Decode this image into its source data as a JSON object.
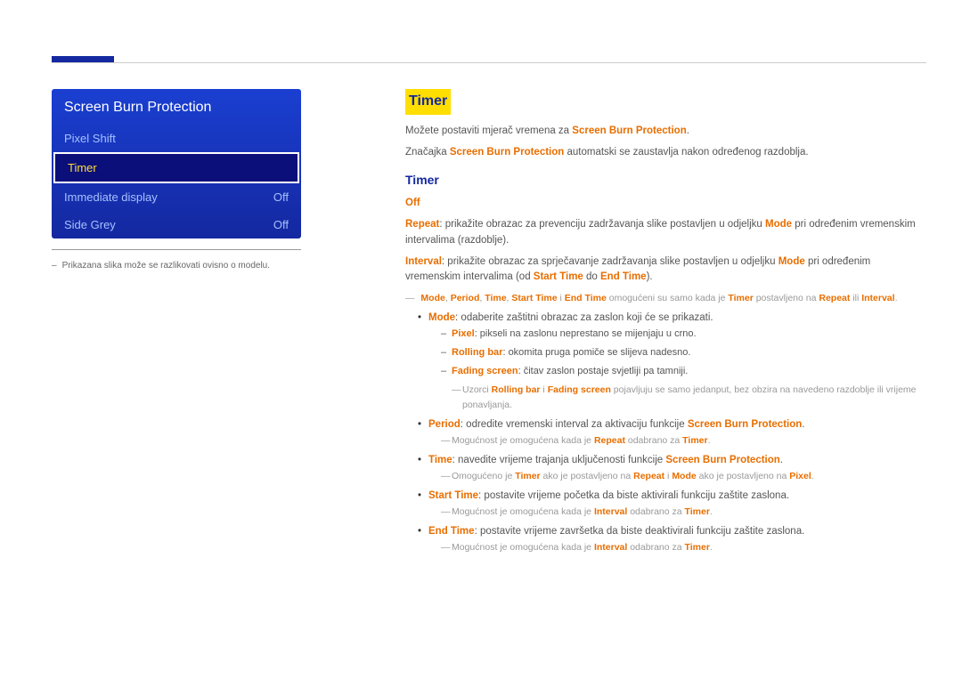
{
  "menu": {
    "title": "Screen Burn Protection",
    "items": [
      {
        "label": "Pixel Shift",
        "value": ""
      },
      {
        "label": "Timer",
        "value": ""
      },
      {
        "label": "Immediate display",
        "value": "Off"
      },
      {
        "label": "Side Grey",
        "value": "Off"
      }
    ]
  },
  "caption": "Prikazana slika može se razlikovati ovisno o modelu.",
  "section_title": "Timer",
  "intro1_a": "Možete postaviti mjerač vremena za ",
  "intro1_b": "Screen Burn Protection",
  "intro1_c": ".",
  "intro2_a": "Značajka ",
  "intro2_b": "Screen Burn Protection",
  "intro2_c": " automatski se zaustavlja nakon određenog razdoblja.",
  "sub_title": "Timer",
  "off_label": "Off",
  "repeat": {
    "lead": "Repeat",
    "mid": ": prikažite obrazac za prevenciju zadržavanja slike postavljen u odjeljku ",
    "mode": "Mode",
    "tail": " pri određenim vremenskim intervalima (razdoblje)."
  },
  "interval": {
    "lead": "Interval",
    "mid": ": prikažite obrazac za sprječavanje zadržavanja slike postavljen u odjeljku ",
    "mode": "Mode",
    "tail1": " pri određenim vremenskim intervalima (od ",
    "st": "Start Time",
    "to": " do ",
    "et": "End Time",
    "tail2": ")."
  },
  "note1": {
    "k1": "Mode",
    "k2": "Period",
    "k3": "Time",
    "k4": "Start Time",
    "i": " i ",
    "k5": "End Time",
    "mid": " omogućeni su samo kada je ",
    "timer": "Timer",
    "mid2": " postavljeno na ",
    "r": "Repeat",
    "or": " ili ",
    "int": "Interval",
    "dot": "."
  },
  "mode_line": {
    "lead": "Mode",
    "text": ": odaberite zaštitni obrazac za zaslon koji će se prikazati."
  },
  "pixel_sub": {
    "lead": "Pixel",
    "text": ": pikseli na zaslonu neprestano se mijenjaju u crno."
  },
  "rolling_sub": {
    "lead": "Rolling bar",
    "text": ": okomita pruga pomiče se slijeva nadesno."
  },
  "fading_sub": {
    "lead": "Fading screen",
    "text": ": čitav zaslon postaje svjetliji pa tamniji."
  },
  "pattern_note": {
    "a": "Uzorci ",
    "rb": "Rolling bar",
    "i": " i ",
    "fs": "Fading screen",
    "b": " pojavljuju se samo jedanput, bez obzira na navedeno razdoblje ili vrijeme ponavljanja."
  },
  "period_line": {
    "lead": "Period",
    "text": ": odredite vremenski interval za aktivaciju funkcije ",
    "sbp": "Screen Burn Protection",
    "dot": "."
  },
  "period_note": {
    "a": "Mogućnost je omogućena kada je ",
    "r": "Repeat",
    "b": " odabrano za ",
    "t": "Timer",
    "dot": "."
  },
  "time_line": {
    "lead": "Time",
    "text": ": navedite vrijeme trajanja uključenosti funkcije ",
    "sbp": "Screen Burn Protection",
    "dot": "."
  },
  "time_note": {
    "a": "Omogućeno je ",
    "t": "Timer",
    "b": " ako je postavljeno na ",
    "r": "Repeat",
    "c": " i ",
    "m": "Mode",
    "d": " ako je postavljeno na ",
    "p": "Pixel",
    "dot": "."
  },
  "start_line": {
    "lead": "Start Time",
    "text": ": postavite vrijeme početka da biste aktivirali funkciju zaštite zaslona."
  },
  "start_note": {
    "a": "Mogućnost je omogućena kada je ",
    "i": "Interval",
    "b": " odabrano za ",
    "t": "Timer",
    "dot": "."
  },
  "end_line": {
    "lead": "End Time",
    "text": ": postavite vrijeme završetka da biste deaktivirali funkciju zaštite zaslona."
  },
  "end_note": {
    "a": "Mogućnost je omogućena kada je ",
    "i": "Interval",
    "b": " odabrano za ",
    "t": "Timer",
    "dot": "."
  }
}
